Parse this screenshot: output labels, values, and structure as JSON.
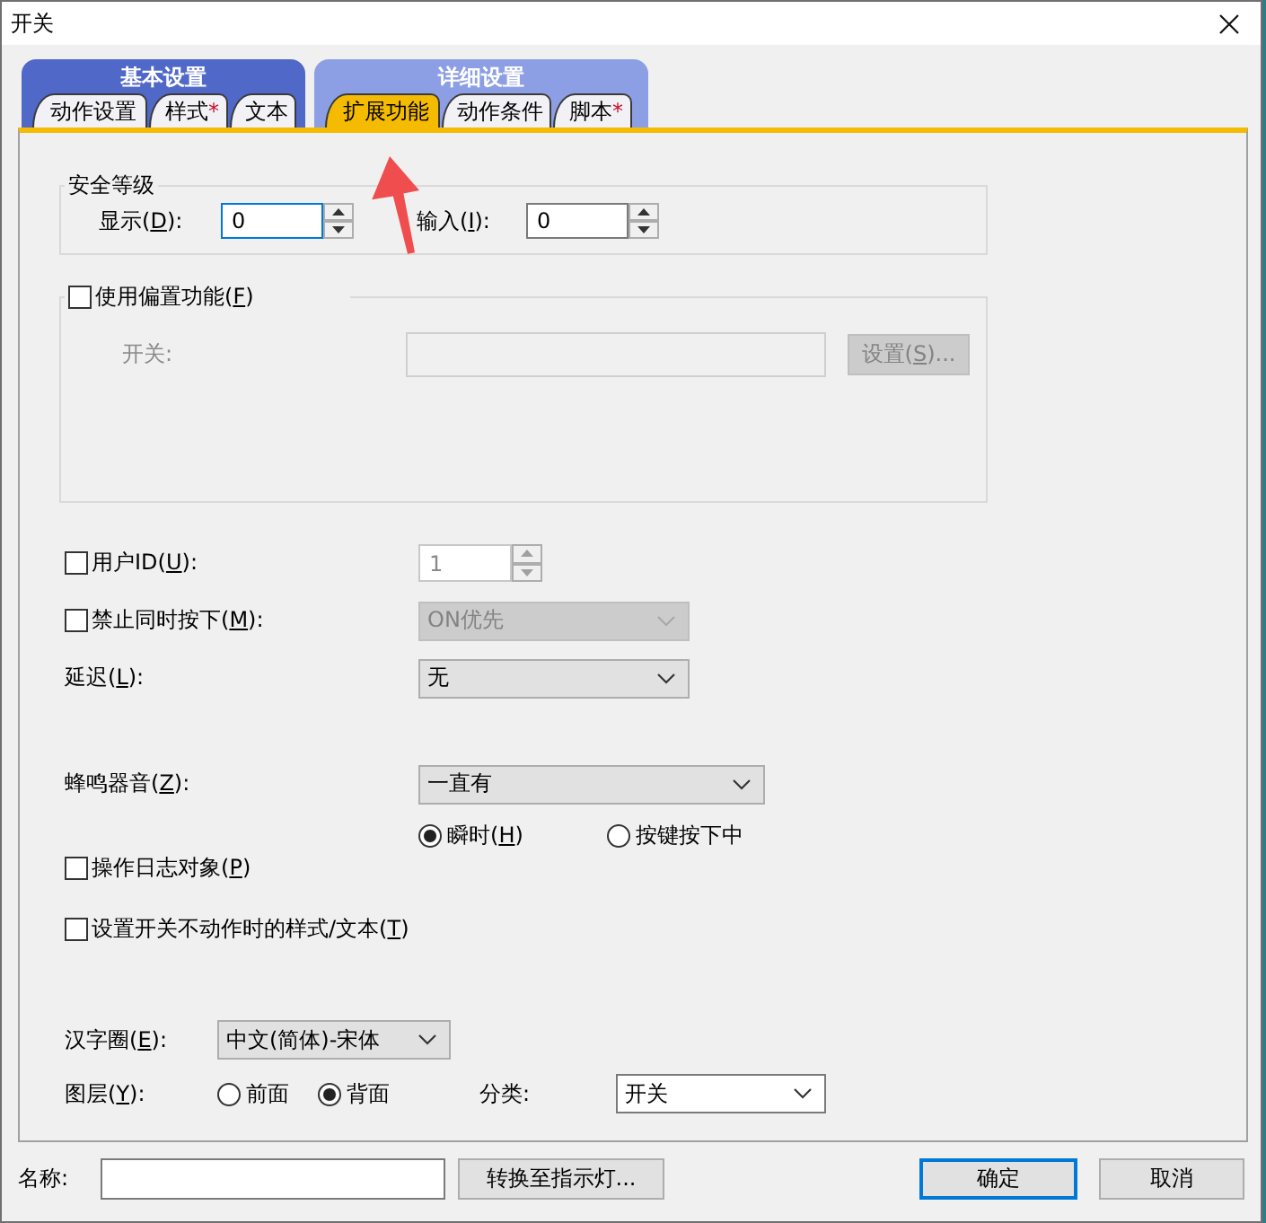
{
  "window": {
    "title": "开关"
  },
  "tab_groups": [
    {
      "title": "基本设置",
      "selected": false,
      "tabs": [
        {
          "label": "动作设置",
          "selected": false
        },
        {
          "label": "样式",
          "marker": "*",
          "selected": false
        },
        {
          "label": "文本",
          "selected": false
        }
      ]
    },
    {
      "title": "详细设置",
      "selected": true,
      "tabs": [
        {
          "label": "扩展功能",
          "selected": true
        },
        {
          "label": "动作条件",
          "selected": false
        },
        {
          "label": "脚本",
          "marker": "*",
          "selected": false
        }
      ]
    }
  ],
  "security_level": {
    "title": "安全等级",
    "display": {
      "label": [
        "显示(",
        "D",
        "):"
      ],
      "value": "0",
      "focused": true
    },
    "input": {
      "label": [
        "输入(",
        "I",
        "):"
      ],
      "value": "0",
      "focused": false
    }
  },
  "offset_function": {
    "label": [
      "使用偏置功能(",
      "F",
      ")"
    ],
    "checked": false,
    "switch_label": "开关:",
    "settings_button": [
      "设置(",
      "S",
      ")..."
    ]
  },
  "user_id": {
    "label": [
      "用户ID(",
      "U",
      "):"
    ],
    "checked": false,
    "value": "1"
  },
  "prevent_simultaneous": {
    "label": [
      "禁止同时按下(",
      "M",
      "):"
    ],
    "checked": false,
    "value": "ON优先"
  },
  "delay": {
    "label": [
      "延迟(",
      "L",
      "):"
    ],
    "value": "无"
  },
  "buzzer": {
    "label": [
      "蜂鸣器音(",
      "Z",
      "):"
    ],
    "value": "一直有",
    "options": [
      {
        "label": [
          "瞬时(",
          "H",
          ")"
        ],
        "selected": true
      },
      {
        "label": [
          "按键按下中"
        ],
        "selected": false
      }
    ]
  },
  "operation_log": {
    "label": [
      "操作日志对象(",
      "P",
      ")"
    ],
    "checked": false
  },
  "inactive_style": {
    "label": [
      "设置开关不动作时的样式/文本(",
      "T",
      ")"
    ],
    "checked": false
  },
  "character_set": {
    "label": [
      "汉字圈(",
      "E",
      "):"
    ],
    "value": "中文(简体)-宋体"
  },
  "layer": {
    "label": [
      "图层(",
      "Y",
      "):"
    ],
    "options": [
      {
        "label": [
          "前面"
        ],
        "selected": false
      },
      {
        "label": [
          "背面"
        ],
        "selected": true
      }
    ]
  },
  "category": {
    "label": [
      "分类:"
    ],
    "value": "开关"
  },
  "footer": {
    "name_label": "名称:",
    "buttons": [
      {
        "label": [
          "转换至指示灯..."
        ],
        "focused": false
      },
      {
        "label": [
          "确定"
        ],
        "focused": true
      },
      {
        "label": [
          "取消"
        ],
        "focused": false
      }
    ]
  }
}
